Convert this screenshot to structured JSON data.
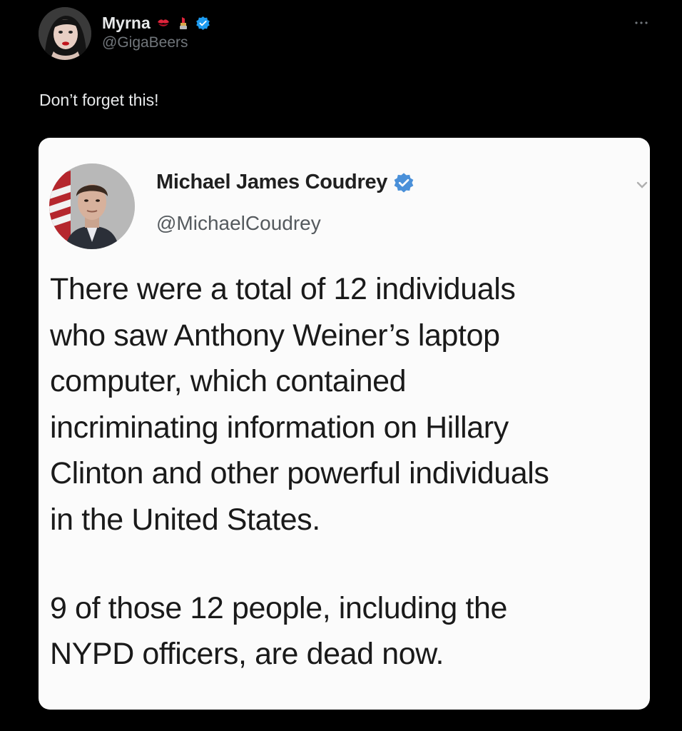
{
  "post": {
    "author": {
      "display_name": "Myrna",
      "emojis": [
        "kiss-mark-emoji",
        "lipstick-emoji"
      ],
      "verified": true,
      "handle": "@GigaBeers"
    },
    "more_icon": "more-horizontal-icon",
    "text": "Don’t forget this!",
    "media": {
      "quoted_author": {
        "display_name": "Michael James Coudrey",
        "verified": true,
        "handle": "@MichaelCoudrey"
      },
      "body_lines": [
        "There were a total of 12 individuals",
        "who saw Anthony Weiner’s laptop",
        "computer, which contained",
        "incriminating information on Hillary",
        "Clinton and other powerful individuals",
        "in the United States."
      ],
      "second_paragraph_lines": [
        "9 of those 12 people, including the",
        "NYPD officers, are dead now."
      ]
    }
  },
  "colors": {
    "background": "#000000",
    "primary_text": "#e7e9ea",
    "secondary_text": "#71767b",
    "verified_blue": "#1d9bf0",
    "media_background": "#fbfbfb",
    "media_text": "#1a1a1a"
  }
}
